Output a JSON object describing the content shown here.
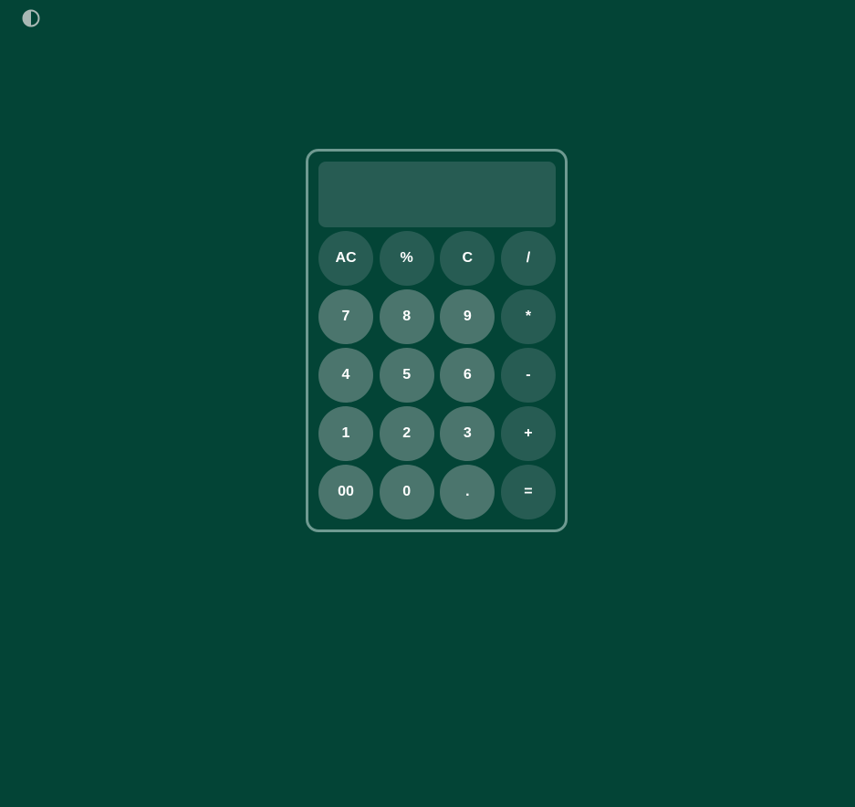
{
  "theme_toggle": {
    "icon": "half-circle-contrast-icon"
  },
  "display": {
    "value": ""
  },
  "keys": [
    {
      "label": "AC",
      "kind": "fn",
      "name": "all-clear-button"
    },
    {
      "label": "%",
      "kind": "fn",
      "name": "percent-button"
    },
    {
      "label": "C",
      "kind": "fn",
      "name": "clear-button"
    },
    {
      "label": "/",
      "kind": "op",
      "name": "divide-button"
    },
    {
      "label": "7",
      "kind": "num",
      "name": "digit-7-button"
    },
    {
      "label": "8",
      "kind": "num",
      "name": "digit-8-button"
    },
    {
      "label": "9",
      "kind": "num",
      "name": "digit-9-button"
    },
    {
      "label": "*",
      "kind": "op",
      "name": "multiply-button"
    },
    {
      "label": "4",
      "kind": "num",
      "name": "digit-4-button"
    },
    {
      "label": "5",
      "kind": "num",
      "name": "digit-5-button"
    },
    {
      "label": "6",
      "kind": "num",
      "name": "digit-6-button"
    },
    {
      "label": "-",
      "kind": "op",
      "name": "subtract-button"
    },
    {
      "label": "1",
      "kind": "num",
      "name": "digit-1-button"
    },
    {
      "label": "2",
      "kind": "num",
      "name": "digit-2-button"
    },
    {
      "label": "3",
      "kind": "num",
      "name": "digit-3-button"
    },
    {
      "label": "+",
      "kind": "op",
      "name": "add-button"
    },
    {
      "label": "00",
      "kind": "num",
      "name": "double-zero-button"
    },
    {
      "label": "0",
      "kind": "num",
      "name": "digit-0-button"
    },
    {
      "label": ".",
      "kind": "num",
      "name": "decimal-button"
    },
    {
      "label": "=",
      "kind": "op",
      "name": "equals-button"
    }
  ],
  "colors": {
    "background": "#034436",
    "border": "#6f9a91",
    "function_key": "#275c53",
    "number_key": "#4b756d",
    "display": "#275c53",
    "text": "#ffffff"
  }
}
